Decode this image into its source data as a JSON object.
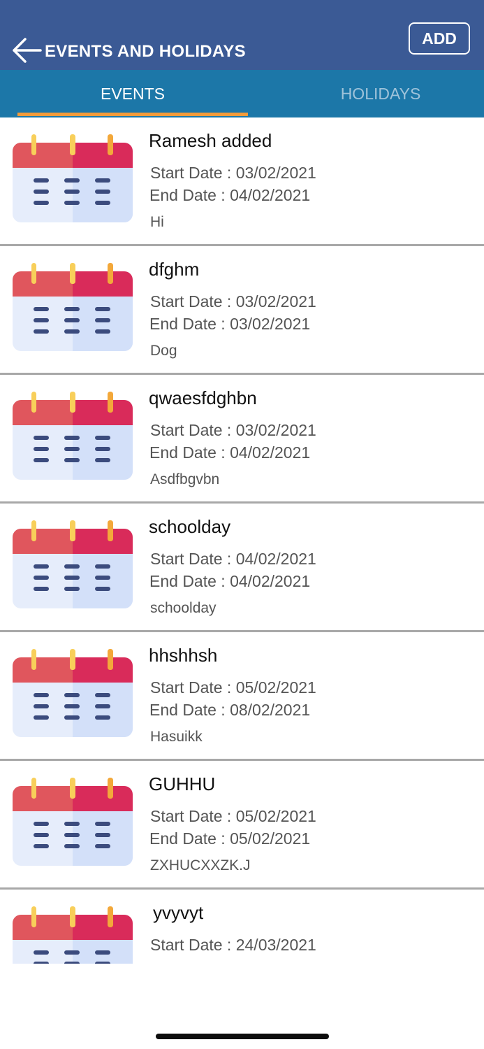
{
  "header": {
    "title": "EVENTS AND HOLIDAYS",
    "add_label": "ADD",
    "back_icon": "arrow-left-icon",
    "background_color": "#3b5a95"
  },
  "tabs": [
    {
      "label": "EVENTS",
      "active": true
    },
    {
      "label": "HOLIDAYS",
      "active": false
    }
  ],
  "tab_bar_color": "#1c77a8",
  "tab_indicator_color": "#f39b3a",
  "event_icon": "calendar-icon",
  "events": [
    {
      "title": "Ramesh added",
      "start": "Start Date : 03/02/2021",
      "end": "End Date : 04/02/2021",
      "description": "Hi"
    },
    {
      "title": "dfghm",
      "start": "Start Date : 03/02/2021",
      "end": "End Date : 03/02/2021",
      "description": "Dog"
    },
    {
      "title": "qwaesfdghbn",
      "start": "Start Date : 03/02/2021",
      "end": "End Date : 04/02/2021",
      "description": "Asdfbgvbn"
    },
    {
      "title": "schoolday",
      "start": "Start Date : 04/02/2021",
      "end": "End Date : 04/02/2021",
      "description": "schoolday"
    },
    {
      "title": "hhshhsh",
      "start": "Start Date : 05/02/2021",
      "end": "End Date : 08/02/2021",
      "description": "Hasuikk"
    },
    {
      "title": "GUHHU",
      "start": "Start Date : 05/02/2021",
      "end": "End Date : 05/02/2021",
      "description": "ZXHUCXXZK.J"
    },
    {
      "title": "yvyvyt",
      "start": "Start Date : 24/03/2021",
      "end": "",
      "description": ""
    }
  ]
}
